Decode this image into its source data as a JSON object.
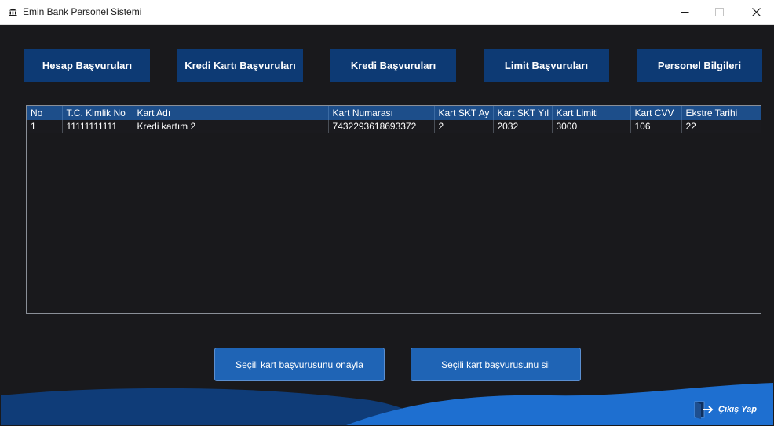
{
  "window": {
    "title": "Emin Bank Personel Sistemi",
    "minimize_label": "─",
    "maximize_label": "☐",
    "close_label": "✕"
  },
  "nav": {
    "hesap_label": "Hesap Başvuruları",
    "kredi_karti_label": "Kredi Kartı Başvuruları",
    "kredi_label": "Kredi Başvuruları",
    "limit_label": "Limit  Başvuruları",
    "personel_label": "Personel Bilgileri"
  },
  "table": {
    "columns": [
      "No",
      "T.C. Kimlik No",
      "Kart Adı",
      "Kart Numarası",
      "Kart SKT Ay",
      "Kart SKT Yıl",
      "Kart Limiti",
      "Kart CVV",
      "Ekstre Tarihi"
    ],
    "rows": [
      [
        "1",
        "11111111111",
        "Kredi kartım 2",
        "7432293618693372",
        "2",
        "2032",
        "3000",
        "106",
        "22"
      ]
    ]
  },
  "actions": {
    "approve_label": "Seçili kart başvurusunu onayla",
    "delete_label": "Seçili kart başvurusunu sil"
  },
  "footer": {
    "exit_label": "Çıkış Yap"
  },
  "colors": {
    "background": "#19191c",
    "nav_button": "#0d3a74",
    "table_header": "#1d4e8a",
    "action_button": "#1f64b5",
    "wave_dark": "#0f3c78",
    "wave_light": "#1e6fd0"
  }
}
